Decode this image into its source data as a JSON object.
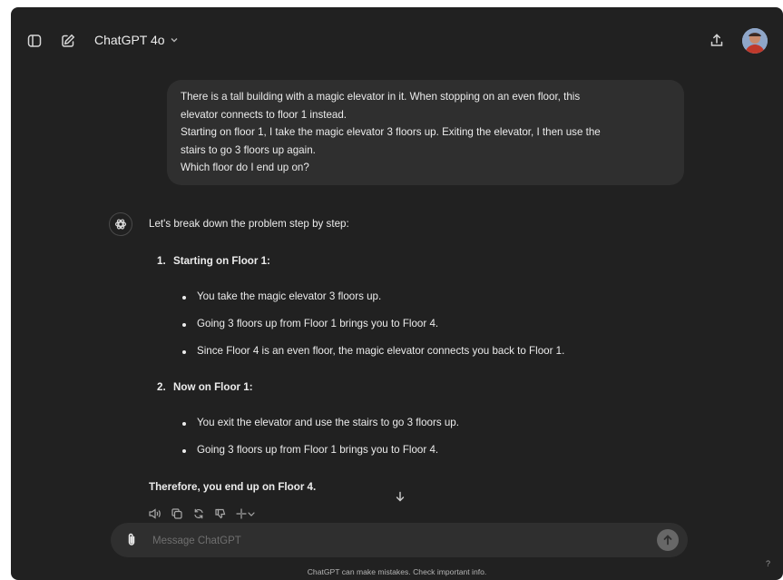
{
  "header": {
    "model_name": "ChatGPT 4o"
  },
  "user_message": {
    "lines": [
      "There is a tall building with a magic elevator in it. When stopping on an even floor, this",
      "elevator connects to floor 1 instead.",
      "Starting on floor 1, I take the magic elevator 3 floors up. Exiting the elevator, I then use the",
      "stairs to go 3 floors up again.",
      "Which floor do I end up on?"
    ]
  },
  "assistant_message": {
    "intro": "Let's break down the problem step by step:",
    "steps": [
      {
        "number": "1.",
        "title": "Starting on Floor 1:",
        "bullets": [
          "You take the magic elevator 3 floors up.",
          "Going 3 floors up from Floor 1 brings you to Floor 4.",
          "Since Floor 4 is an even floor, the magic elevator connects you back to Floor 1."
        ]
      },
      {
        "number": "2.",
        "title": "Now on Floor 1:",
        "bullets": [
          "You exit the elevator and use the stairs to go 3 floors up.",
          "Going 3 floors up from Floor 1 brings you to Floor 4."
        ]
      }
    ],
    "conclusion": "Therefore, you end up on Floor 4."
  },
  "composer": {
    "placeholder": "Message ChatGPT"
  },
  "footer": {
    "disclaimer": "ChatGPT can make mistakes. Check important info.",
    "help": "?"
  },
  "icons": {
    "sidebar_toggle": "sidebar-icon",
    "new_chat": "edit-icon",
    "share": "share-icon",
    "assistant": "openai-logo-icon",
    "read_aloud": "speaker-icon",
    "copy": "copy-icon",
    "regenerate": "refresh-icon",
    "dislike": "thumbs-down-icon",
    "change_model": "sparkle-icon",
    "attach": "paperclip-icon",
    "send": "arrow-up-icon",
    "scroll_down": "arrow-down-icon"
  },
  "colors": {
    "background": "#212121",
    "bubble": "#2f2f2f",
    "text": "#ececec",
    "send_button": "#676767"
  }
}
